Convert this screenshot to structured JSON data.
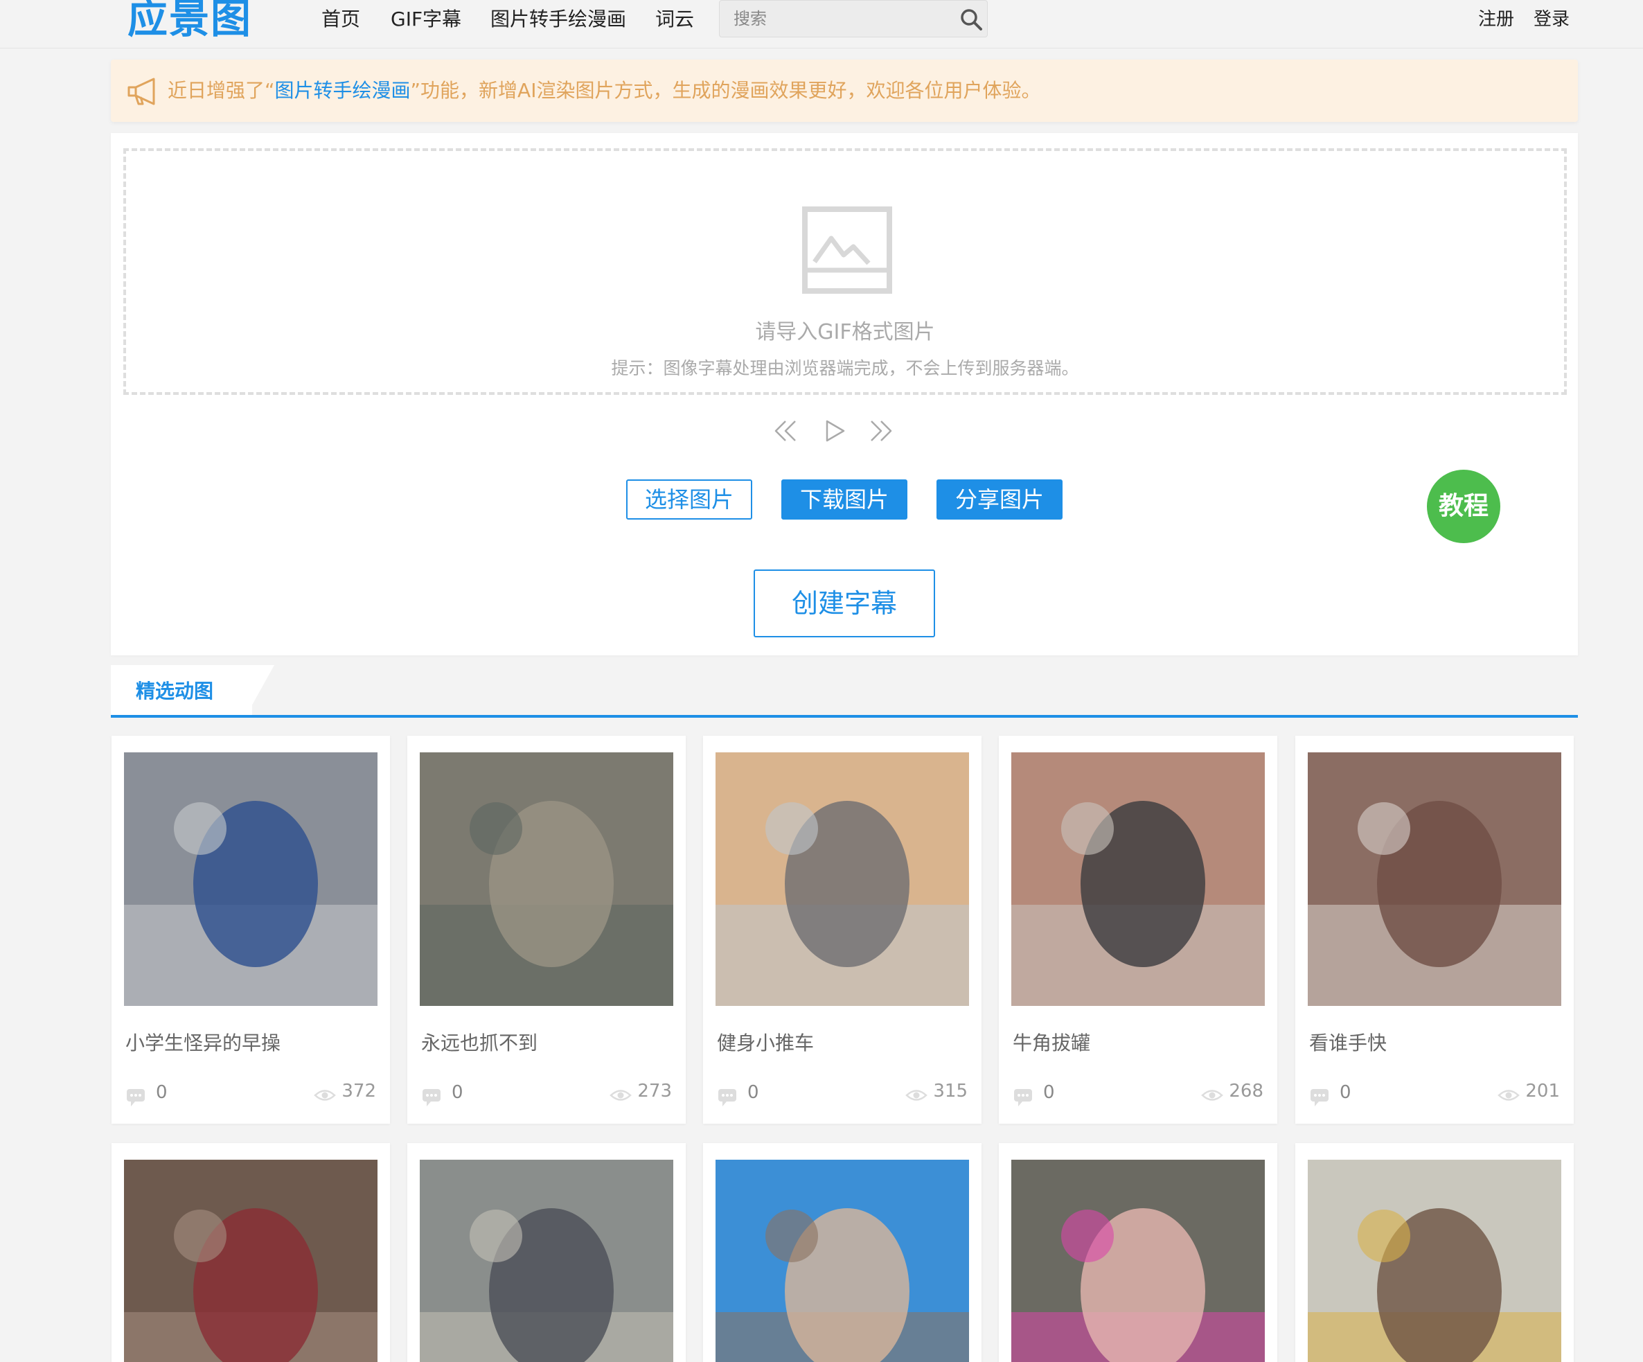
{
  "logo": {
    "text": "应景图"
  },
  "nav": {
    "items": [
      {
        "label": "首页"
      },
      {
        "label": "GIF字幕"
      },
      {
        "label": "图片转手绘漫画"
      },
      {
        "label": "词云"
      }
    ],
    "search_placeholder": "搜索",
    "register": "注册",
    "login": "登录"
  },
  "notice": {
    "prefix": "近日增强了“",
    "link": "图片转手绘漫画",
    "suffix": "”功能，新增AI渲染图片方式，生成的漫画效果更好，欢迎各位用户体验。"
  },
  "editor": {
    "dropzone_title": "请导入GIF格式图片",
    "dropzone_hint": "提示：图像字幕处理由浏览器端完成，不会上传到服务器端。",
    "select_button": "选择图片",
    "download_button": "下载图片",
    "share_button": "分享图片",
    "create_button": "创建字幕",
    "tutorial_button": "教程"
  },
  "section": {
    "tab_label": "精选动图"
  },
  "gifs": [
    {
      "title": "小学生怪异的早操",
      "comments": "0",
      "views": "372",
      "palette": [
        "#8a8f98",
        "#2d4f8e",
        "#c7c9cc"
      ]
    },
    {
      "title": "永远也抓不到",
      "comments": "0",
      "views": "273",
      "palette": [
        "#7c7a70",
        "#9a9384",
        "#5d6660"
      ]
    },
    {
      "title": "健身小推车",
      "comments": "0",
      "views": "315",
      "palette": [
        "#d9b48e",
        "#6e6e72",
        "#bfc6cc"
      ]
    },
    {
      "title": "牛角拔罐",
      "comments": "0",
      "views": "268",
      "palette": [
        "#b58a7a",
        "#3b3b3e",
        "#c9c3bd"
      ]
    },
    {
      "title": "看谁手快",
      "comments": "0",
      "views": "201",
      "palette": [
        "#8b6d63",
        "#6f4e45",
        "#d8d0cb"
      ]
    },
    {
      "title": "",
      "comments": "",
      "views": "",
      "palette": [
        "#6e5a4e",
        "#8a2d35",
        "#a58e80"
      ]
    },
    {
      "title": "",
      "comments": "",
      "views": "",
      "palette": [
        "#8a8e8c",
        "#4b4f58",
        "#c3c0b5"
      ]
    },
    {
      "title": "",
      "comments": "",
      "views": "",
      "palette": [
        "#3c8fd6",
        "#d8b59a",
        "#8a7260"
      ]
    },
    {
      "title": "",
      "comments": "",
      "views": "",
      "palette": [
        "#6b6a62",
        "#e6b7b0",
        "#d946a8"
      ]
    },
    {
      "title": "",
      "comments": "",
      "views": "",
      "palette": [
        "#c9c7bd",
        "#6e5444",
        "#d8b04a"
      ]
    }
  ]
}
